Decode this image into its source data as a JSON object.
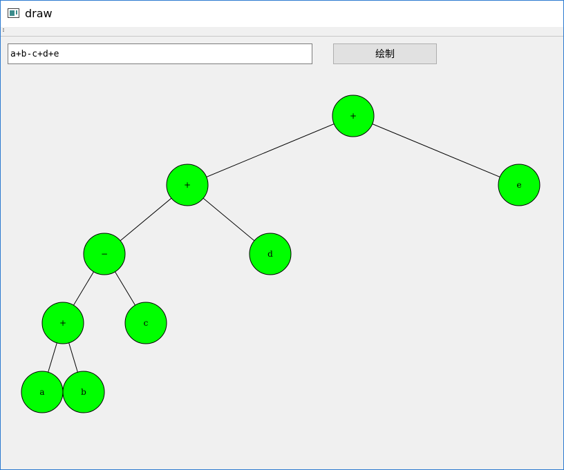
{
  "window": {
    "title": "draw",
    "icon": "app-window-icon"
  },
  "toolbar": {
    "grip_icon": "toolbar-grip-icon"
  },
  "input": {
    "value": "a+b-c+d+e"
  },
  "draw_button": {
    "label": "绘制"
  },
  "tree": {
    "node_color": "#00ff00",
    "edge_color": "#000000",
    "nodes": [
      {
        "id": "n1",
        "label": "+"
      },
      {
        "id": "n2",
        "label": "+"
      },
      {
        "id": "n3",
        "label": "e"
      },
      {
        "id": "n4",
        "label": "−"
      },
      {
        "id": "n5",
        "label": "d"
      },
      {
        "id": "n6",
        "label": "+"
      },
      {
        "id": "n7",
        "label": "c"
      },
      {
        "id": "n8",
        "label": "a"
      },
      {
        "id": "n9",
        "label": "b"
      }
    ],
    "edges": [
      [
        "n1",
        "n2"
      ],
      [
        "n1",
        "n3"
      ],
      [
        "n2",
        "n4"
      ],
      [
        "n2",
        "n5"
      ],
      [
        "n4",
        "n6"
      ],
      [
        "n4",
        "n7"
      ],
      [
        "n6",
        "n8"
      ],
      [
        "n6",
        "n9"
      ]
    ]
  }
}
